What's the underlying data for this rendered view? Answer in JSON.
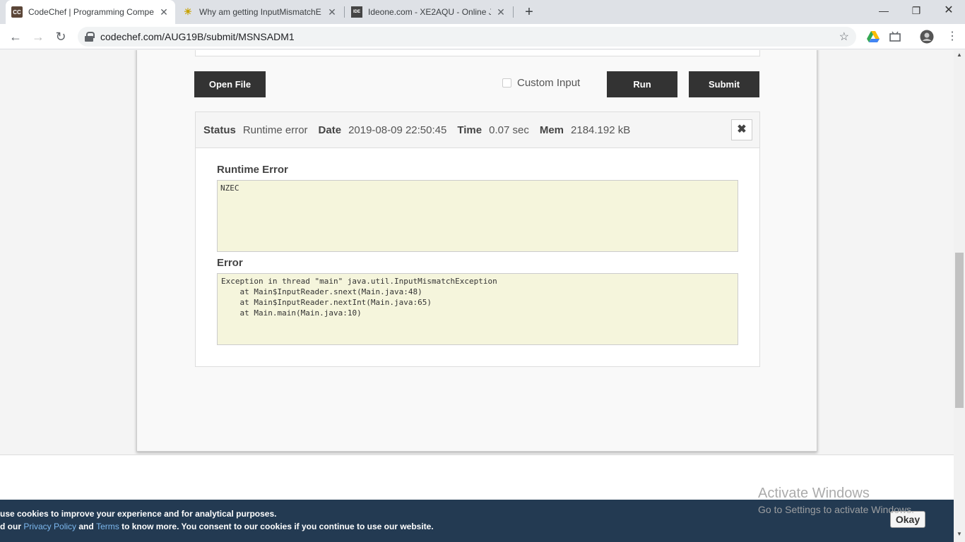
{
  "browser": {
    "tabs": [
      {
        "title": "CodeChef | Programming Compe",
        "favicon": "CC"
      },
      {
        "title": "Why am getting InputMismatchE",
        "favicon": ""
      },
      {
        "title": "Ideone.com - XE2AQU - Online J",
        "favicon": "IDE"
      }
    ],
    "new_tab": "+",
    "window": {
      "minimize": "—",
      "restore": "❐",
      "close": "✕"
    },
    "nav": {
      "back": "←",
      "forward": "→",
      "reload": "↻"
    },
    "url": "codechef.com/AUG19B/submit/MSNSADM1",
    "bookmark": "☆"
  },
  "submit": {
    "open_file": "Open File",
    "custom_input": "Custom Input",
    "run": "Run",
    "submit": "Submit"
  },
  "result": {
    "status_label": "Status",
    "status_value": "Runtime error",
    "date_label": "Date",
    "date_value": "2019-08-09 22:50:45",
    "time_label": "Time",
    "time_value": "0.07 sec",
    "mem_label": "Mem",
    "mem_value": "2184.192 kB",
    "close": "✖",
    "runtime_error_label": "Runtime Error",
    "runtime_error_text": "NZEC",
    "error_label": "Error",
    "error_text": "Exception in thread \"main\" java.util.InputMismatchException\n\tat Main$InputReader.snext(Main.java:48)\n\tat Main$InputReader.nextInt(Main.java:65)\n\tat Main.main(Main.java:10)"
  },
  "watermark": {
    "line1": "Activate Windows",
    "line2": "Go to Settings to activate Windows."
  },
  "cookie": {
    "line1": "use cookies to improve your experience and for analytical purposes.",
    "line2_a": "d our",
    "privacy": "Privacy Policy",
    "and": "and",
    "terms": "Terms",
    "line2_b": "to know more. You consent to our cookies if you continue to use our website.",
    "okay": "Okay"
  },
  "scroll": {
    "up": "▲",
    "down": "▼"
  }
}
